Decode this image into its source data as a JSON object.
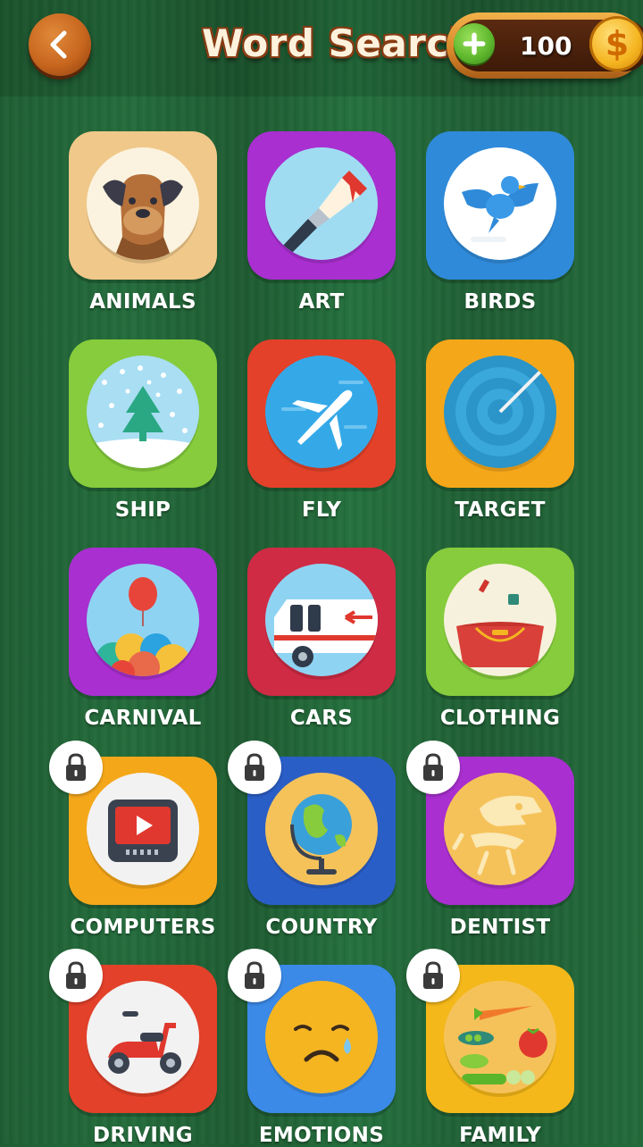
{
  "header": {
    "title": "Word Search",
    "coins": "100",
    "coin_symbol": "$"
  },
  "categories": [
    {
      "label": "ANIMALS",
      "color": "#f0c88a",
      "locked": false,
      "icon": "dog-icon"
    },
    {
      "label": "ART",
      "color": "#a92fd0",
      "locked": false,
      "icon": "paintbrush-icon"
    },
    {
      "label": "BIRDS",
      "color": "#2f8ad9",
      "locked": false,
      "icon": "bird-icon"
    },
    {
      "label": "SHIP",
      "color": "#86cc3c",
      "locked": false,
      "icon": "snow-tree-icon"
    },
    {
      "label": "FLY",
      "color": "#e3412a",
      "locked": false,
      "icon": "airplane-icon"
    },
    {
      "label": "TARGET",
      "color": "#f5a71a",
      "locked": false,
      "icon": "target-icon"
    },
    {
      "label": "CARNIVAL",
      "color": "#a92fd0",
      "locked": false,
      "icon": "balloons-icon"
    },
    {
      "label": "CARS",
      "color": "#cf2b45",
      "locked": false,
      "icon": "ambulance-icon"
    },
    {
      "label": "CLOTHING",
      "color": "#86cc3c",
      "locked": false,
      "icon": "handbag-icon"
    },
    {
      "label": "COMPUTERS",
      "color": "#f5a71a",
      "locked": true,
      "icon": "monitor-icon"
    },
    {
      "label": "COUNTRY",
      "color": "#2a5ec7",
      "locked": true,
      "icon": "globe-icon"
    },
    {
      "label": "DENTIST",
      "color": "#a92fd0",
      "locked": true,
      "icon": "dinosaur-skeleton-icon"
    },
    {
      "label": "DRIVING",
      "color": "#e3412a",
      "locked": true,
      "icon": "scooter-icon"
    },
    {
      "label": "EMOTIONS",
      "color": "#3b8ae8",
      "locked": true,
      "icon": "sad-face-icon"
    },
    {
      "label": "FAMILY",
      "color": "#f5b81a",
      "locked": true,
      "icon": "vegetables-icon"
    }
  ]
}
